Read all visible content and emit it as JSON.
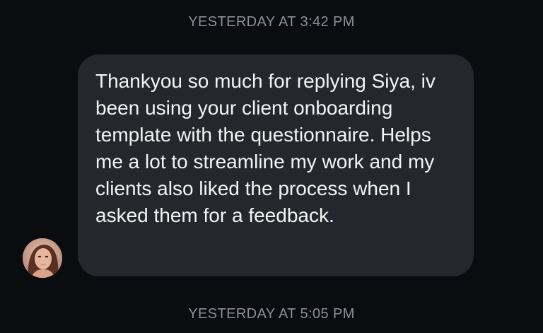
{
  "conversation": {
    "timestamp_top": "YESTERDAY AT 3:42 PM",
    "message": {
      "text": "Thankyou so much for replying Siya, iv been using your client onboarding template with the questionnaire. Helps me a lot to streamline my work and my clients also liked the process when I asked them for a feedback."
    },
    "sender_avatar_icon": "profile-photo-avatar",
    "timestamp_bottom": "YESTERDAY AT 5:05 PM"
  },
  "colors": {
    "background": "#0b0c10",
    "bubble": "#26272c",
    "message_text": "#f4f4f5",
    "timestamp_text": "#8e8f96"
  }
}
